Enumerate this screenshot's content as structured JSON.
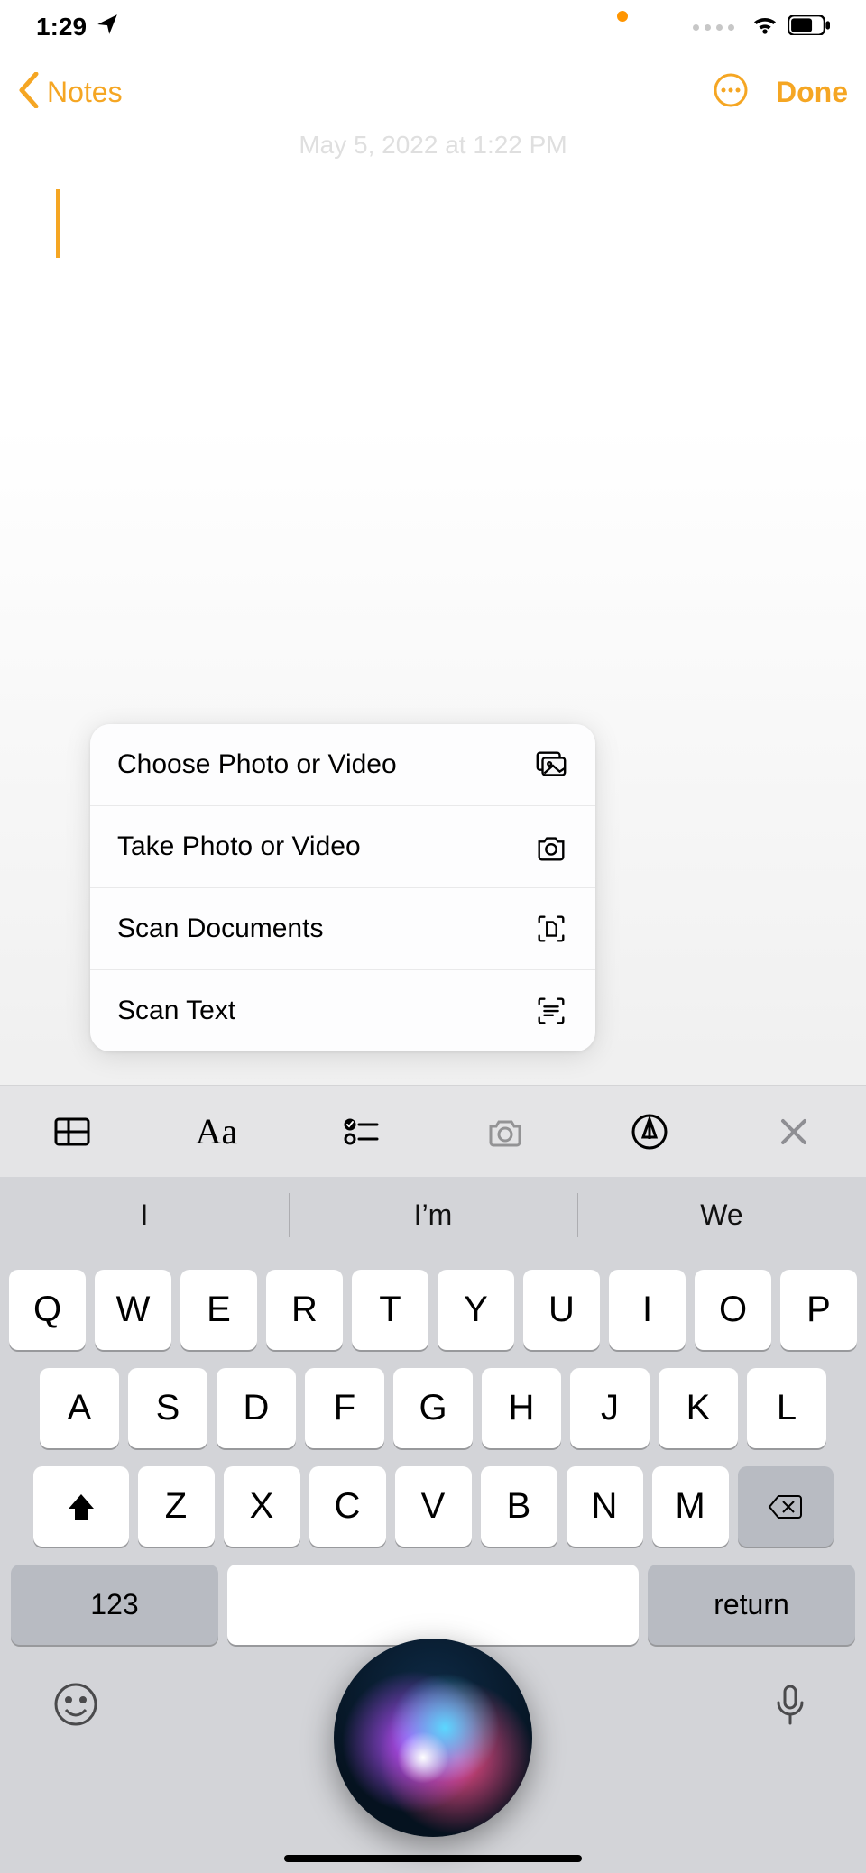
{
  "status": {
    "time": "1:29"
  },
  "nav": {
    "back_label": "Notes",
    "done_label": "Done"
  },
  "editor": {
    "timestamp": "May 5, 2022 at 1:22 PM"
  },
  "menu": {
    "items": [
      {
        "label": "Choose Photo or Video"
      },
      {
        "label": "Take Photo or Video"
      },
      {
        "label": "Scan Documents"
      },
      {
        "label": "Scan Text"
      }
    ]
  },
  "toolbar": {
    "text_style": "Aa"
  },
  "predictions": [
    "I",
    "I’m",
    "We"
  ],
  "keyboard": {
    "row1": [
      "Q",
      "W",
      "E",
      "R",
      "T",
      "Y",
      "U",
      "I",
      "O",
      "P"
    ],
    "row2": [
      "A",
      "S",
      "D",
      "F",
      "G",
      "H",
      "J",
      "K",
      "L"
    ],
    "row3": [
      "Z",
      "X",
      "C",
      "V",
      "B",
      "N",
      "M"
    ],
    "num_key": "123",
    "return_key": "return"
  }
}
